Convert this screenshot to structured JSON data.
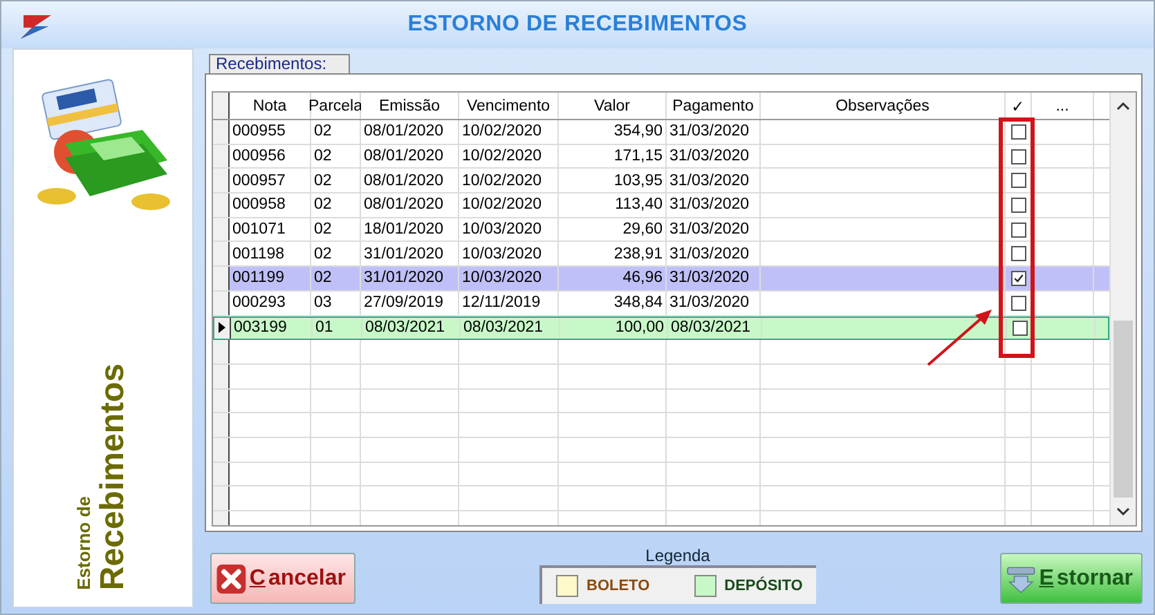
{
  "window": {
    "title": "ESTORNO DE RECEBIMENTOS"
  },
  "sidebar": {
    "subtitle": "Estorno de",
    "title": "Recebimentos"
  },
  "group": {
    "label": "Recebimentos:"
  },
  "table": {
    "columns": [
      "Nota",
      "Parcela",
      "Emissão",
      "Vencimento",
      "Valor",
      "Pagamento",
      "Observações",
      "✓",
      "..."
    ],
    "rows": [
      {
        "cells": [
          "000955",
          "02",
          "08/01/2020",
          "10/02/2020",
          "354,90",
          "31/03/2020"
        ],
        "checked": false,
        "selected": false,
        "current": false,
        "kind": "plain"
      },
      {
        "cells": [
          "000956",
          "02",
          "08/01/2020",
          "10/02/2020",
          "171,15",
          "31/03/2020"
        ],
        "checked": false,
        "selected": false,
        "current": false,
        "kind": "plain"
      },
      {
        "cells": [
          "000957",
          "02",
          "08/01/2020",
          "10/02/2020",
          "103,95",
          "31/03/2020"
        ],
        "checked": false,
        "selected": false,
        "current": false,
        "kind": "plain"
      },
      {
        "cells": [
          "000958",
          "02",
          "08/01/2020",
          "10/02/2020",
          "113,40",
          "31/03/2020"
        ],
        "checked": false,
        "selected": false,
        "current": false,
        "kind": "plain"
      },
      {
        "cells": [
          "001071",
          "02",
          "18/01/2020",
          "10/03/2020",
          "29,60",
          "31/03/2020"
        ],
        "checked": false,
        "selected": false,
        "current": false,
        "kind": "plain"
      },
      {
        "cells": [
          "001198",
          "02",
          "31/01/2020",
          "10/03/2020",
          "238,91",
          "31/03/2020"
        ],
        "checked": false,
        "selected": false,
        "current": false,
        "kind": "plain"
      },
      {
        "cells": [
          "001199",
          "02",
          "31/01/2020",
          "10/03/2020",
          "46,96",
          "31/03/2020"
        ],
        "checked": true,
        "selected": true,
        "current": false,
        "kind": "plain"
      },
      {
        "cells": [
          "000293",
          "03",
          "27/09/2019",
          "12/11/2019",
          "348,84",
          "31/03/2020"
        ],
        "checked": false,
        "selected": false,
        "current": false,
        "kind": "plain"
      },
      {
        "cells": [
          "003199",
          "01",
          "08/03/2021",
          "08/03/2021",
          "100,00",
          "08/03/2021"
        ],
        "checked": false,
        "selected": false,
        "current": true,
        "kind": "deposit"
      }
    ]
  },
  "legend": {
    "title": "Legenda",
    "items": [
      {
        "label": "BOLETO",
        "color": "#fff8c8"
      },
      {
        "label": "DEPÓSITO",
        "color": "#c8f8c8"
      }
    ]
  },
  "buttons": [
    {
      "label": "Cancelar",
      "kind": "cancel"
    },
    {
      "label": "Estornar",
      "kind": "confirm"
    }
  ]
}
